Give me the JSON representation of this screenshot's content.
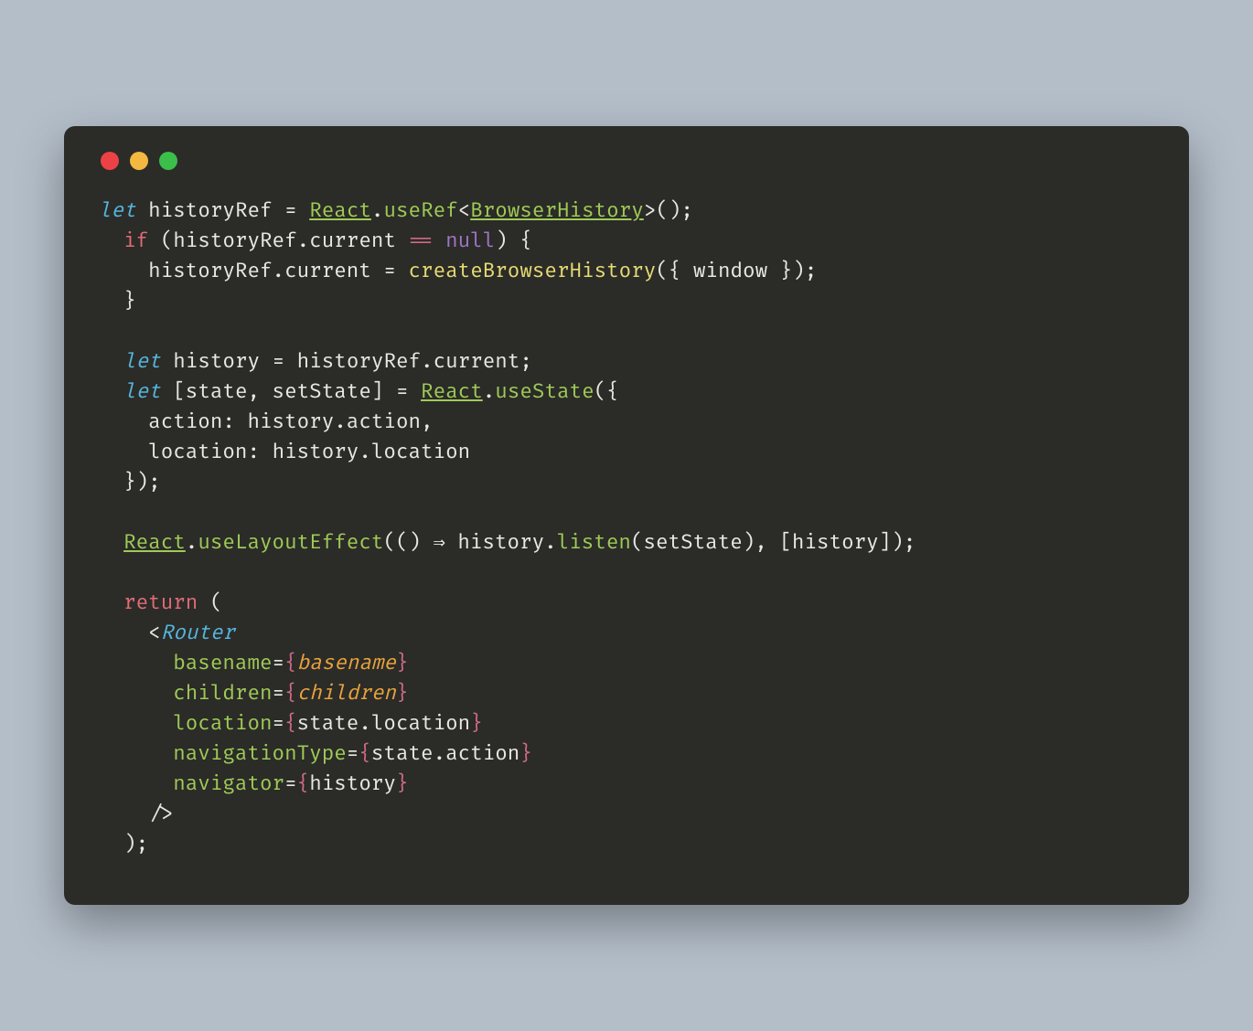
{
  "window": {
    "traffic_lights": [
      "close",
      "minimize",
      "zoom"
    ]
  },
  "code": {
    "line1": {
      "let": "let",
      "ident": "historyRef",
      "eq": "=",
      "react": "React",
      "dot": ".",
      "useRef": "useRef",
      "lt": "<",
      "type": "BrowserHistory",
      "gt": ">();"
    },
    "line2": {
      "if": "if",
      "open": "(historyRef.current",
      "eqeq": "==",
      "null": "null",
      "close": ") {"
    },
    "line3": {
      "lhs": "historyRef.current",
      "eq": "=",
      "fn": "createBrowserHistory",
      "args": "({ window });"
    },
    "line4": {
      "brace": "}"
    },
    "line6": {
      "let": "let",
      "ident": "history",
      "eq": "=",
      "rhs": "historyRef.current;"
    },
    "line7": {
      "let": "let",
      "destruct": "[state, setState]",
      "eq": "=",
      "react": "React",
      "dot": ".",
      "useState": "useState",
      "open": "({"
    },
    "line8": {
      "prop": "action:",
      "val": "history.action,"
    },
    "line9": {
      "prop": "location:",
      "val": "history.location"
    },
    "line10": {
      "close": "});"
    },
    "line12": {
      "react": "React",
      "dot": ".",
      "fn": "useLayoutEffect",
      "open": "(()",
      "arrow": "⇒",
      "rhs1": "history.",
      "listen": "listen",
      "rhs2": "(setState), [history]);"
    },
    "line14": {
      "return": "return",
      "open": "("
    },
    "line15": {
      "lt": "<",
      "router": "Router"
    },
    "line16": {
      "attr": "basename",
      "eq": "=",
      "lb": "{",
      "val": "basename",
      "rb": "}"
    },
    "line17": {
      "attr": "children",
      "eq": "=",
      "lb": "{",
      "val": "children",
      "rb": "}"
    },
    "line18": {
      "attr": "location",
      "eq": "=",
      "lb": "{",
      "val": "state.location",
      "rb": "}"
    },
    "line19": {
      "attr": "navigationType",
      "eq": "=",
      "lb": "{",
      "val": "state.action",
      "rb": "}"
    },
    "line20": {
      "attr": "navigator",
      "eq": "=",
      "lb": "{",
      "val": "history",
      "rb": "}"
    },
    "line21": {
      "close": "/>"
    },
    "line22": {
      "close": ");"
    }
  }
}
